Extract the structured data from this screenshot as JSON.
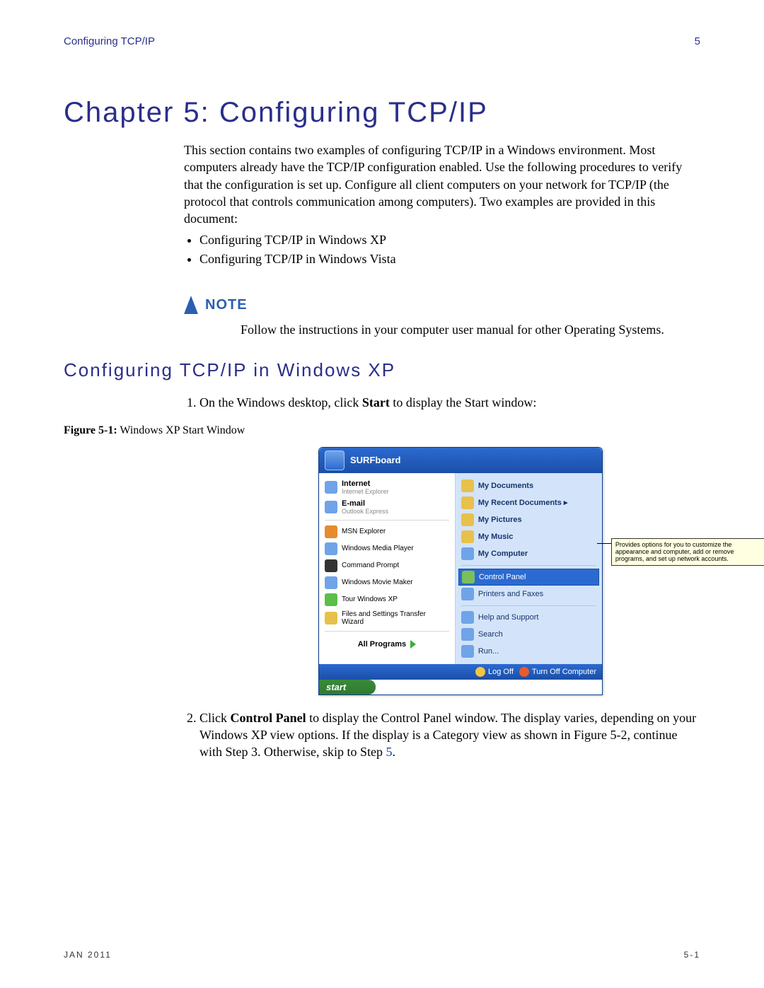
{
  "header": {
    "left": "Configuring TCP/IP",
    "right": "5"
  },
  "chapter": {
    "title": "Chapter 5: Configuring TCP/IP"
  },
  "intro": "This section contains two examples of configuring TCP/IP in a Windows environment. Most computers already have the TCP/IP configuration enabled. Use the following procedures to verify that the configuration is set up. Configure all client computers on your network for TCP/IP (the protocol that controls communication among computers). Two examples are provided in this document:",
  "intro_bullets": [
    "Configuring TCP/IP in Windows XP",
    "Configuring TCP/IP in Windows Vista"
  ],
  "note": {
    "label": "NOTE",
    "body": "Follow the instructions in your computer user manual for other Operating Systems."
  },
  "section1": {
    "heading": "Configuring TCP/IP in Windows XP"
  },
  "step1": {
    "prefix": "On the Windows desktop, click ",
    "bold": "Start",
    "suffix": " to display the Start window:"
  },
  "figure1": {
    "label": "Figure 5-1:",
    "title": " Windows XP Start Window"
  },
  "startmenu": {
    "username": "SURFboard",
    "left_pinned": [
      {
        "title": "Internet",
        "sub": "Internet Explorer"
      },
      {
        "title": "E-mail",
        "sub": "Outlook Express"
      }
    ],
    "left_items": [
      "MSN Explorer",
      "Windows Media Player",
      "Command Prompt",
      "Windows Movie Maker",
      "Tour Windows XP",
      "Files and Settings Transfer Wizard"
    ],
    "all_programs": "All Programs",
    "right_items_top": [
      "My Documents",
      "My Recent Documents  ▸",
      "My Pictures",
      "My Music",
      "My Computer"
    ],
    "right_highlight": "Control Panel",
    "right_items_bottom": [
      "Printers and Faxes",
      "Help and Support",
      "Search",
      "Run..."
    ],
    "tooltip": "Provides options for you to customize the appearance and computer, add or remove programs, and set up network accounts.",
    "logoff": "Log Off",
    "turnoff": "Turn Off Computer",
    "startbtn": "start"
  },
  "step2": {
    "prefix": "Click ",
    "bold": "Control Panel",
    "middle": " to display the Control Panel window. The display varies, depending on your Windows XP view options. If the display is a Category view as shown in Figure 5-2, continue with Step 3. Otherwise, skip to Step ",
    "link": "5",
    "suffix": "."
  },
  "footer": {
    "left": "JAN 2011",
    "right": "5-1"
  }
}
